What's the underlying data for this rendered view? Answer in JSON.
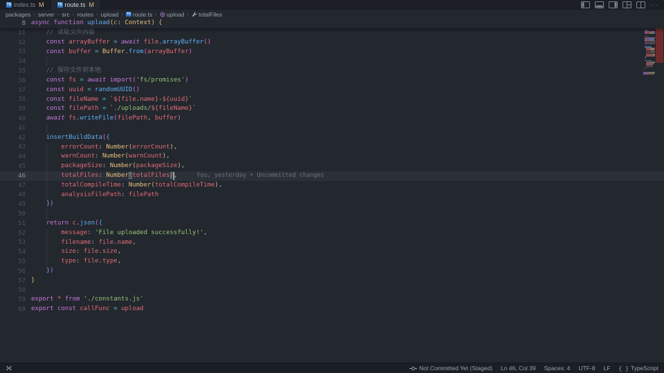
{
  "tab_bar": {
    "tabs": [
      {
        "label": "index.ts",
        "git_badge": "M",
        "active": false
      },
      {
        "label": "route.ts",
        "git_badge": "M",
        "active": true
      }
    ],
    "actions": [
      "toggle-primary-sidebar",
      "toggle-panel",
      "toggle-secondary-sidebar",
      "customize-layout",
      "split-editor",
      "more-actions"
    ]
  },
  "breadcrumbs": [
    {
      "label": "packages"
    },
    {
      "label": "server"
    },
    {
      "label": "src"
    },
    {
      "label": "routes"
    },
    {
      "label": "upload"
    },
    {
      "label": "route.ts",
      "icon": "file-ts"
    },
    {
      "label": "upload",
      "icon": "symbol-method"
    },
    {
      "label": "totalFiles",
      "icon": "symbol-property"
    }
  ],
  "editor": {
    "sticky_line": {
      "num": "8",
      "segs": [
        [
          "ki",
          "async "
        ],
        [
          "k",
          "function "
        ],
        [
          "f",
          "upload"
        ],
        [
          "b1",
          "("
        ],
        [
          "a",
          "c"
        ],
        [
          "p",
          ": "
        ],
        [
          "c",
          "Context"
        ],
        [
          "b1",
          ") {"
        ]
      ]
    },
    "lines": [
      {
        "num": "31",
        "segs": [
          [
            "p",
            "    "
          ],
          [
            "m",
            "// 读取文件内容"
          ]
        ]
      },
      {
        "num": "32",
        "segs": [
          [
            "p",
            "    "
          ],
          [
            "k",
            "const "
          ],
          [
            "v",
            "arrayBuffer"
          ],
          [
            "o",
            " = "
          ],
          [
            "ki",
            "await "
          ],
          [
            "v",
            "file"
          ],
          [
            "p",
            "."
          ],
          [
            "f",
            "arrayBuffer"
          ],
          [
            "b2",
            "()"
          ]
        ]
      },
      {
        "num": "33",
        "segs": [
          [
            "p",
            "    "
          ],
          [
            "k",
            "const "
          ],
          [
            "v",
            "buffer"
          ],
          [
            "o",
            " = "
          ],
          [
            "c",
            "Buffer"
          ],
          [
            "p",
            "."
          ],
          [
            "f",
            "from"
          ],
          [
            "b2",
            "("
          ],
          [
            "v",
            "arrayBuffer"
          ],
          [
            "b2",
            ")"
          ]
        ]
      },
      {
        "num": "34",
        "segs": [],
        "g": 1
      },
      {
        "num": "35",
        "segs": [
          [
            "p",
            "    "
          ],
          [
            "m",
            "// 保存文件到本地"
          ]
        ]
      },
      {
        "num": "36",
        "segs": [
          [
            "p",
            "    "
          ],
          [
            "k",
            "const "
          ],
          [
            "v",
            "fs"
          ],
          [
            "o",
            " = "
          ],
          [
            "ki",
            "await "
          ],
          [
            "k",
            "import"
          ],
          [
            "b2",
            "("
          ],
          [
            "s",
            "'fs/promises'"
          ],
          [
            "b2",
            ")"
          ]
        ]
      },
      {
        "num": "37",
        "segs": [
          [
            "p",
            "    "
          ],
          [
            "k",
            "const "
          ],
          [
            "v",
            "uuid"
          ],
          [
            "o",
            " = "
          ],
          [
            "f",
            "randomUUID"
          ],
          [
            "b2",
            "()"
          ]
        ]
      },
      {
        "num": "38",
        "segs": [
          [
            "p",
            "    "
          ],
          [
            "k",
            "const "
          ],
          [
            "v",
            "fileName"
          ],
          [
            "o",
            " = "
          ],
          [
            "s",
            "`"
          ],
          [
            "t",
            "${"
          ],
          [
            "v",
            "file"
          ],
          [
            "p",
            "."
          ],
          [
            "v",
            "name"
          ],
          [
            "t",
            "}"
          ],
          [
            "s",
            "-"
          ],
          [
            "t",
            "${"
          ],
          [
            "v",
            "uuid"
          ],
          [
            "t",
            "}"
          ],
          [
            "s",
            "`"
          ]
        ]
      },
      {
        "num": "39",
        "segs": [
          [
            "p",
            "    "
          ],
          [
            "k",
            "const "
          ],
          [
            "v",
            "filePath"
          ],
          [
            "o",
            " = "
          ],
          [
            "s",
            "`./uploads/"
          ],
          [
            "t",
            "${"
          ],
          [
            "v",
            "fileName"
          ],
          [
            "t",
            "}"
          ],
          [
            "s",
            "`"
          ]
        ]
      },
      {
        "num": "40",
        "segs": [
          [
            "p",
            "    "
          ],
          [
            "ki",
            "await "
          ],
          [
            "v",
            "fs"
          ],
          [
            "p",
            "."
          ],
          [
            "f",
            "writeFile"
          ],
          [
            "b2",
            "("
          ],
          [
            "v",
            "filePath"
          ],
          [
            "p",
            ", "
          ],
          [
            "v",
            "buffer"
          ],
          [
            "b2",
            ")"
          ]
        ]
      },
      {
        "num": "41",
        "segs": [],
        "g": 1
      },
      {
        "num": "42",
        "segs": [
          [
            "p",
            "    "
          ],
          [
            "f",
            "insertBuildData"
          ],
          [
            "b2",
            "("
          ],
          [
            "b3",
            "{"
          ]
        ]
      },
      {
        "num": "43",
        "segs": [
          [
            "p",
            "        "
          ],
          [
            "v",
            "errorCount"
          ],
          [
            "p",
            ": "
          ],
          [
            "c",
            "Number"
          ],
          [
            "b1",
            "("
          ],
          [
            "v",
            "errorCount"
          ],
          [
            "b1",
            ")"
          ],
          [
            "p",
            ","
          ]
        ]
      },
      {
        "num": "44",
        "segs": [
          [
            "p",
            "        "
          ],
          [
            "v",
            "warnCount"
          ],
          [
            "p",
            ": "
          ],
          [
            "c",
            "Number"
          ],
          [
            "b1",
            "("
          ],
          [
            "v",
            "warnCount"
          ],
          [
            "b1",
            ")"
          ],
          [
            "p",
            ","
          ]
        ]
      },
      {
        "num": "45",
        "segs": [
          [
            "p",
            "        "
          ],
          [
            "v",
            "packageSize"
          ],
          [
            "p",
            ": "
          ],
          [
            "c",
            "Number"
          ],
          [
            "b1",
            "("
          ],
          [
            "v",
            "packageSize"
          ],
          [
            "b1",
            ")"
          ],
          [
            "p",
            ","
          ]
        ]
      },
      {
        "num": "46",
        "segs": [
          [
            "p",
            "        "
          ],
          [
            "v",
            "totalFiles"
          ],
          [
            "p",
            ": "
          ],
          [
            "c",
            "Number"
          ],
          [
            "bx",
            "("
          ],
          [
            "v",
            "totalFiles"
          ],
          [
            "bx",
            ")"
          ],
          [
            "p",
            ","
          ]
        ]
      },
      {
        "num": "47",
        "segs": [
          [
            "p",
            "        "
          ],
          [
            "v",
            "totalCompileTime"
          ],
          [
            "p",
            ": "
          ],
          [
            "c",
            "Number"
          ],
          [
            "b1",
            "("
          ],
          [
            "v",
            "totalCompileTime"
          ],
          [
            "b1",
            ")"
          ],
          [
            "p",
            ","
          ]
        ]
      },
      {
        "num": "48",
        "segs": [
          [
            "p",
            "        "
          ],
          [
            "v",
            "analysisFilePath"
          ],
          [
            "p",
            ": "
          ],
          [
            "v",
            "filePath"
          ]
        ]
      },
      {
        "num": "49",
        "segs": [
          [
            "p",
            "    "
          ],
          [
            "b3",
            "}"
          ],
          [
            "b2",
            ")"
          ]
        ]
      },
      {
        "num": "50",
        "segs": [],
        "g": 1
      },
      {
        "num": "51",
        "segs": [
          [
            "p",
            "    "
          ],
          [
            "k",
            "return "
          ],
          [
            "v",
            "c"
          ],
          [
            "p",
            "."
          ],
          [
            "f",
            "json"
          ],
          [
            "b2",
            "("
          ],
          [
            "b3",
            "{"
          ]
        ]
      },
      {
        "num": "52",
        "segs": [
          [
            "p",
            "        "
          ],
          [
            "v",
            "message"
          ],
          [
            "p",
            ": "
          ],
          [
            "s",
            "'File uploaded successfully!'"
          ],
          [
            "p",
            ","
          ]
        ]
      },
      {
        "num": "53",
        "segs": [
          [
            "p",
            "        "
          ],
          [
            "v",
            "filename"
          ],
          [
            "p",
            ": "
          ],
          [
            "v",
            "file"
          ],
          [
            "p",
            "."
          ],
          [
            "v",
            "name"
          ],
          [
            "p",
            ","
          ]
        ]
      },
      {
        "num": "54",
        "segs": [
          [
            "p",
            "        "
          ],
          [
            "v",
            "size"
          ],
          [
            "p",
            ": "
          ],
          [
            "v",
            "file"
          ],
          [
            "p",
            "."
          ],
          [
            "v",
            "size"
          ],
          [
            "p",
            ","
          ]
        ]
      },
      {
        "num": "55",
        "segs": [
          [
            "p",
            "        "
          ],
          [
            "v",
            "type"
          ],
          [
            "p",
            ": "
          ],
          [
            "v",
            "file"
          ],
          [
            "p",
            "."
          ],
          [
            "v",
            "type"
          ],
          [
            "p",
            ","
          ]
        ]
      },
      {
        "num": "56",
        "segs": [
          [
            "p",
            "    "
          ],
          [
            "b3",
            "}"
          ],
          [
            "b2",
            ")"
          ]
        ]
      },
      {
        "num": "57",
        "segs": [
          [
            "b1",
            "}"
          ]
        ]
      },
      {
        "num": "58",
        "segs": [],
        "g": 0
      },
      {
        "num": "59",
        "segs": [
          [
            "k",
            "export "
          ],
          [
            "v",
            "*"
          ],
          [
            "k",
            " from "
          ],
          [
            "s",
            "'./constants.js'"
          ]
        ]
      },
      {
        "num": "60",
        "segs": [
          [
            "k",
            "export "
          ],
          [
            "k",
            "const "
          ],
          [
            "v",
            "callFunc"
          ],
          [
            "o",
            " = "
          ],
          [
            "v",
            "upload"
          ]
        ]
      }
    ],
    "cursor": {
      "line": "46",
      "col": 39
    },
    "blame": {
      "line": "46",
      "text": "You, yesterday • Uncommitted changes"
    }
  },
  "status_bar": {
    "left": [
      {
        "icon": "remote-indicator"
      }
    ],
    "right": [
      {
        "icon": "git-commit",
        "label": "Not Committed Yet (Staged)"
      },
      {
        "label": "Ln 46, Col 39"
      },
      {
        "label": "Spaces: 4"
      },
      {
        "label": "UTF-8"
      },
      {
        "label": "LF"
      },
      {
        "icon": "braces",
        "label": "TypeScript"
      }
    ]
  },
  "colors": {
    "accent": "#61afef",
    "modified_badge": "#e2c08d",
    "ruler_modified": "#6b2b2b",
    "editor_background": "#23272e",
    "chrome_background": "#1b1e24"
  }
}
